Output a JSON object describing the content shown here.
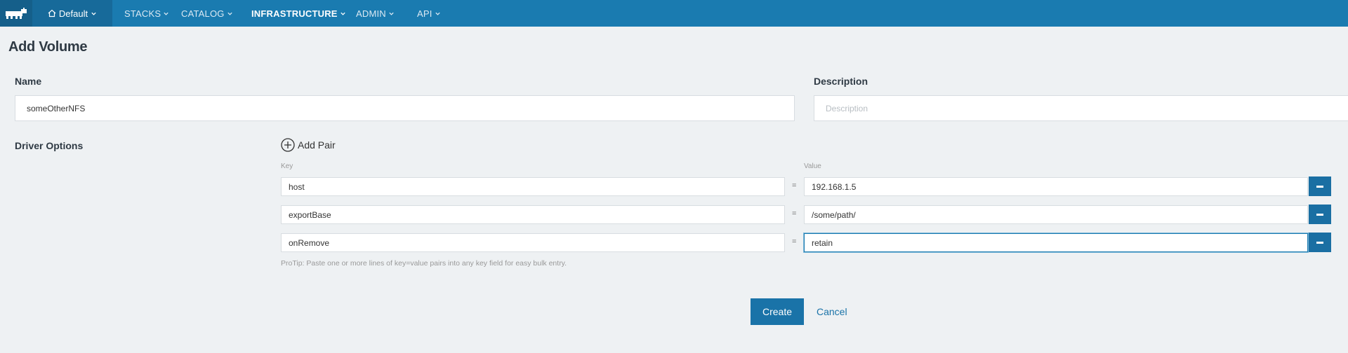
{
  "nav": {
    "environment": "Default",
    "items": [
      {
        "label": "STACKS"
      },
      {
        "label": "CATALOG"
      },
      {
        "label": "INFRASTRUCTURE"
      },
      {
        "label": "ADMIN"
      },
      {
        "label": "API"
      }
    ]
  },
  "page_title": "Add Volume",
  "name": {
    "label": "Name",
    "value": "someOtherNFS"
  },
  "description": {
    "label": "Description",
    "placeholder": "Description"
  },
  "driver_options": {
    "label": "Driver Options",
    "add_pair_label": "Add Pair",
    "key_header": "Key",
    "value_header": "Value",
    "pairs": [
      {
        "key": "host",
        "value": "192.168.1.5"
      },
      {
        "key": "exportBase",
        "value": "/some/path/"
      },
      {
        "key": "onRemove",
        "value": "retain"
      }
    ],
    "separator": "=",
    "protip": "ProTip: Paste one or more lines of key=value pairs into any key field for easy bulk entry."
  },
  "actions": {
    "create_label": "Create",
    "cancel_label": "Cancel"
  },
  "colors": {
    "nav_bg": "#1a7bb0",
    "accent": "#1a73a8",
    "page_bg": "#eef1f3"
  }
}
